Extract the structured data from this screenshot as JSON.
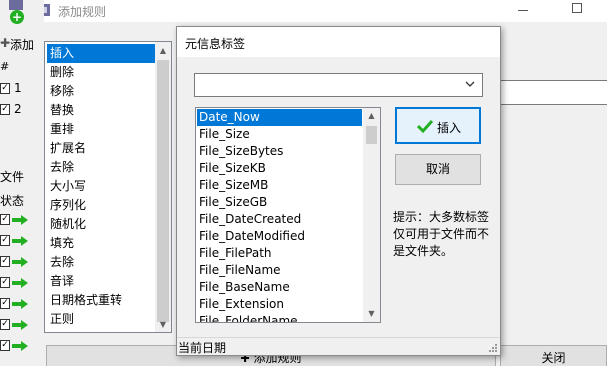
{
  "window": {
    "title": "添加规则"
  },
  "left_panel": {
    "add_label": "添加",
    "hash_header": "#",
    "rules": [
      {
        "index": "1"
      },
      {
        "index": "2"
      }
    ],
    "files_header": "文件",
    "status_header": "状态"
  },
  "rule_types": [
    "插入",
    "删除",
    "移除",
    "替换",
    "重排",
    "扩展名",
    "去除",
    "大小写",
    "序列化",
    "随机化",
    "填充",
    "去除",
    "音译",
    "日期格式重转",
    "正则"
  ],
  "dialog": {
    "title": "元信息标签",
    "combo_value": "",
    "tags": [
      "Date_Now",
      "File_Size",
      "File_SizeBytes",
      "File_SizeKB",
      "File_SizeMB",
      "File_SizeGB",
      "File_DateCreated",
      "File_DateModified",
      "File_FilePath",
      "File_FileName",
      "File_BaseName",
      "File_Extension",
      "File_FolderName"
    ],
    "insert_label": "插入",
    "cancel_label": "取消",
    "hint": "提示：大多数标签仅可用于文件而不是文件夹。",
    "status": "当前日期"
  },
  "bottom": {
    "add_rule_label": "添加规则",
    "close_label": "关闭"
  },
  "colors": {
    "selection": "#0078d7",
    "ok_green": "#22b022"
  }
}
